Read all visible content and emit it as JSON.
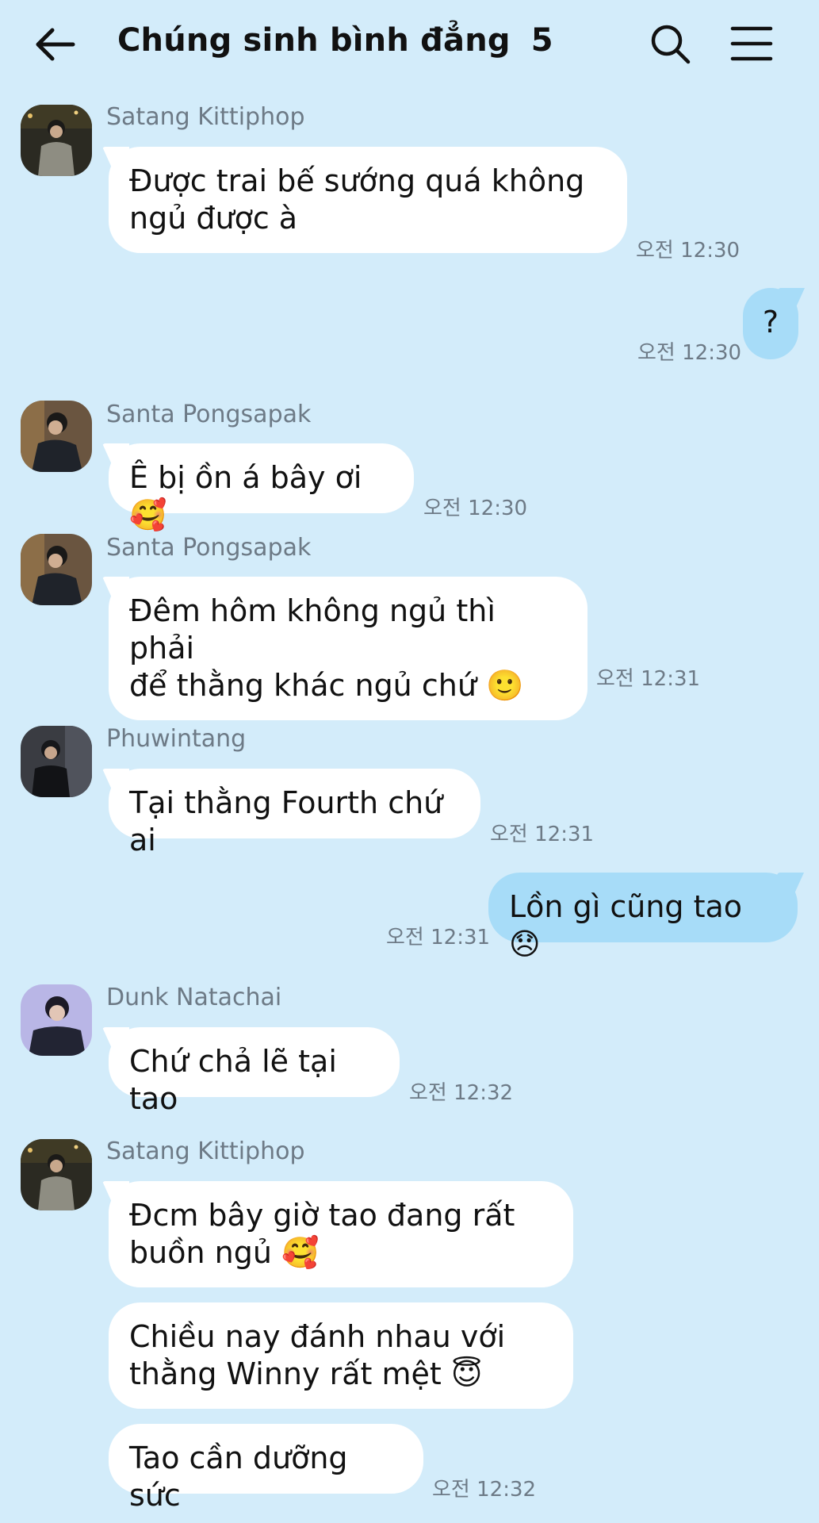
{
  "header": {
    "back_label": "←",
    "title": "Chúng sinh bình đẳng",
    "member_count": "5"
  },
  "colors": {
    "background": "#d3ecfa",
    "incoming_bubble": "#ffffff",
    "outgoing_bubble": "#a7dcf8",
    "meta_text": "#6d7a86"
  },
  "icons": [
    "back-arrow-icon",
    "search-icon",
    "hamburger-menu-icon"
  ],
  "messages": [
    {
      "sender": "Satang Kittiphop",
      "text": "Được trai bế sướng quá không\nngủ được à",
      "time": "오전 12:30"
    },
    {
      "sender": "",
      "text": "?",
      "time": "오전 12:30"
    },
    {
      "sender": "Santa Pongsapak",
      "text": "Ê bị ồn á bây ơi 🥰",
      "time": "오전 12:30"
    },
    {
      "sender": "Santa Pongsapak",
      "text": "Đêm hôm không ngủ thì phải\nđể thằng khác ngủ chứ 🙂",
      "time": "오전 12:31"
    },
    {
      "sender": "Phuwintang",
      "text": "Tại thằng Fourth chứ ai",
      "time": "오전 12:31"
    },
    {
      "sender": "",
      "text": "Lồn gì cũng tao 😞",
      "time": "오전 12:31"
    },
    {
      "sender": "Dunk Natachai",
      "text": "Chứ chả lẽ tại tao",
      "time": "오전 12:32"
    },
    {
      "sender": "Satang Kittiphop",
      "text": "Đcm bây giờ tao đang rất\nbuồn ngủ 🥰",
      "time": ""
    },
    {
      "sender": "",
      "text": "Chiều nay đánh nhau với\nthằng Winny rất mệt 😇",
      "time": ""
    },
    {
      "sender": "",
      "text": "Tao cần dưỡng sức",
      "time": "오전 12:32"
    }
  ]
}
